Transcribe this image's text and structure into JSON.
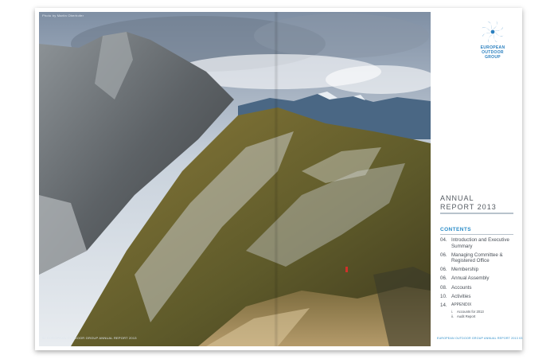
{
  "photo": {
    "credit": "Photo by Martin Oberhofer",
    "footer_left": "02  EUROPEAN OUTDOOR GROUP ANNUAL REPORT 2013"
  },
  "logo": {
    "line1": "EUROPEAN",
    "line2": "OUTDOOR",
    "line3": "GROUP",
    "color": "#2a7fbf"
  },
  "title": {
    "line1": "ANNUAL",
    "line2": "REPORT 2013"
  },
  "contents": {
    "heading": "CONTENTS",
    "items": [
      {
        "num": "04.",
        "label": "Introduction and Executive Summary"
      },
      {
        "num": "06.",
        "label": "Managing Committee & Registered Office"
      },
      {
        "num": "06.",
        "label": "Membership"
      },
      {
        "num": "06.",
        "label": "Annual Assembly"
      },
      {
        "num": "08.",
        "label": "Accounts"
      },
      {
        "num": "10.",
        "label": "Activities"
      },
      {
        "num": "14.",
        "label": "APPENDIX"
      }
    ],
    "subitems": [
      {
        "num": "i.",
        "label": "Accounts for 2013"
      },
      {
        "num": "ii.",
        "label": "Audit Report"
      }
    ]
  },
  "footer_right": "EUROPEAN OUTDOOR GROUP ANNUAL REPORT 2013  03",
  "colors": {
    "accent": "#2a8cc8",
    "text": "#4a5058"
  }
}
